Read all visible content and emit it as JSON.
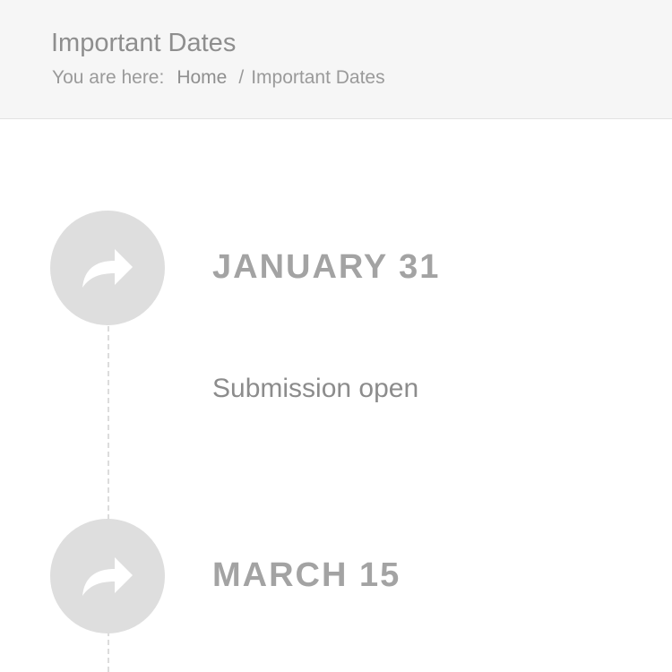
{
  "header": {
    "title": "Important Dates",
    "breadcrumb": {
      "prefix": "You are here:",
      "items": [
        {
          "label": "Home"
        },
        {
          "label": "Important Dates"
        }
      ],
      "separator": "/"
    }
  },
  "timeline": {
    "icon": "share-arrow-icon",
    "events": [
      {
        "date": "JANUARY 31",
        "description": "Submission open"
      },
      {
        "date": "MARCH 15"
      }
    ]
  },
  "colors": {
    "header_background": "#f6f6f6",
    "circle": "#dedede",
    "date_text": "#a3a3a3",
    "body_text": "#8c8c8c"
  }
}
